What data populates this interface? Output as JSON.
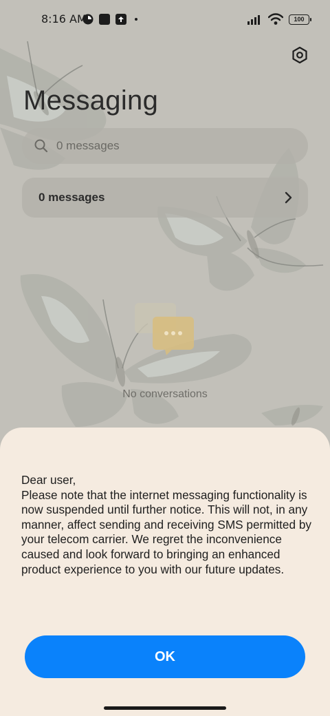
{
  "status_bar": {
    "time": "8:16 AM",
    "battery": "100"
  },
  "header": {
    "title": "Messaging",
    "settings_icon": "gear-icon"
  },
  "search": {
    "placeholder": "0 messages",
    "icon": "search-icon"
  },
  "messages_card": {
    "label": "0 messages",
    "icon": "chevron-right-icon"
  },
  "empty_state": {
    "text": "No conversations",
    "icon": "chat-bubble-icon"
  },
  "dialog": {
    "message": "Dear user,\nPlease note that the internet messaging functionality is now suspended until further notice. This will not, in any manner, affect sending and receiving SMS permitted by your telecom carrier. We regret the inconvenience caused and look forward to bringing an enhanced product experience to you with our future updates.",
    "ok_label": "OK"
  },
  "colors": {
    "accent": "#0a82fb",
    "sheet_background": "#f5ebe0",
    "screen_background": "#c2c0b9"
  }
}
